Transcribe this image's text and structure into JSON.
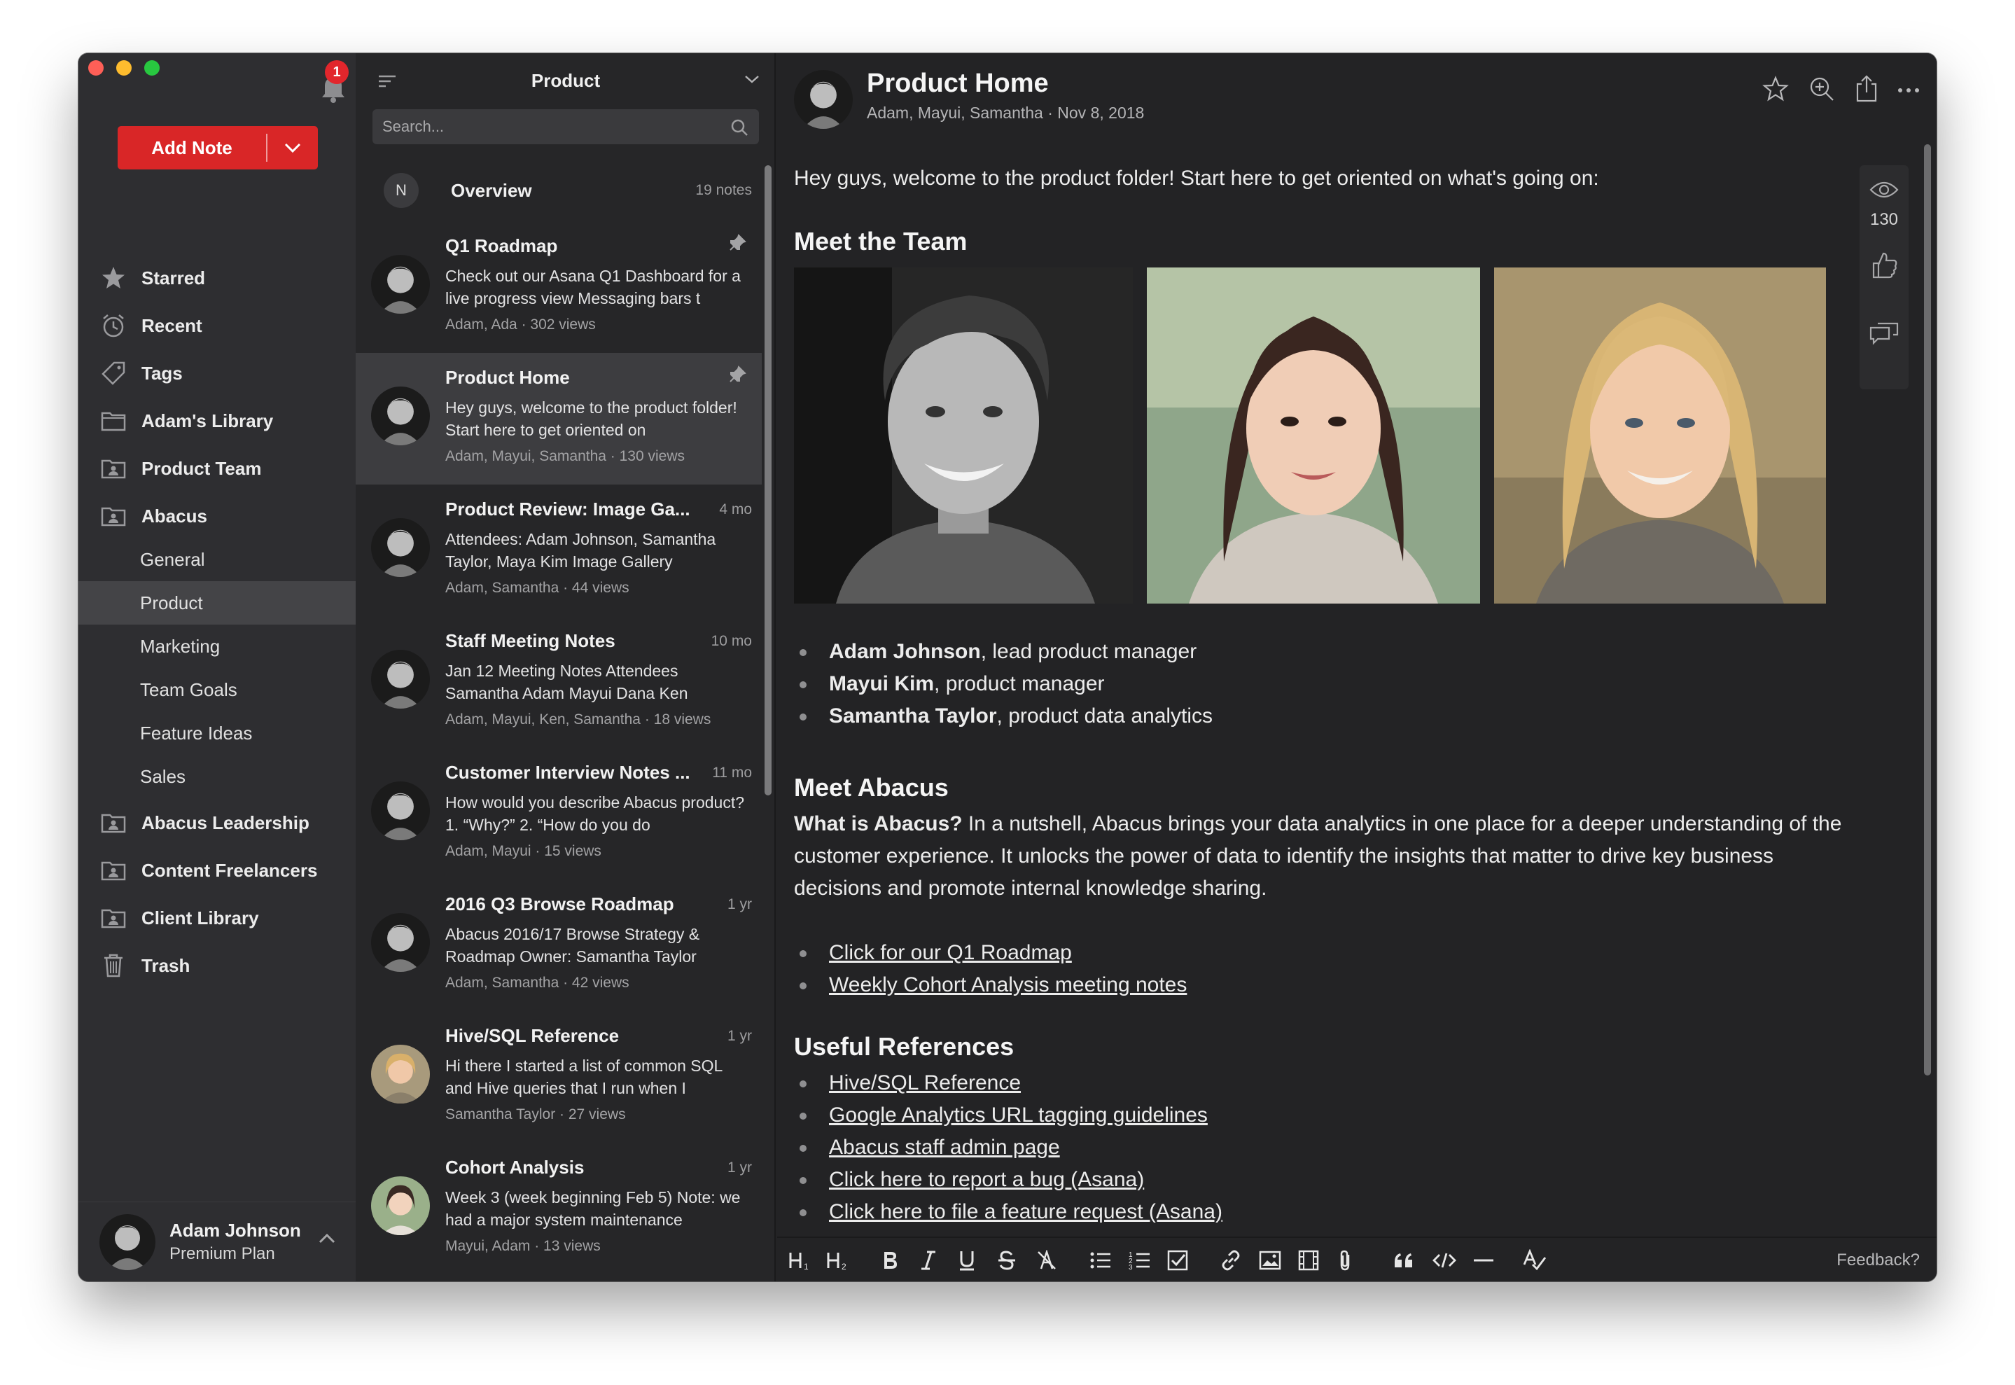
{
  "sidebar": {
    "notification_count": "1",
    "add_note_label": "Add Note",
    "nav": [
      {
        "label": "Starred",
        "icon": "star-icon"
      },
      {
        "label": "Recent",
        "icon": "alarm-clock-icon"
      },
      {
        "label": "Tags",
        "icon": "tag-icon"
      },
      {
        "label": "Adam's Library",
        "icon": "folder-icon"
      },
      {
        "label": "Product Team",
        "icon": "shared-folder-icon"
      },
      {
        "label": "Abacus",
        "icon": "shared-folder-icon"
      }
    ],
    "subnav": [
      "General",
      "Product",
      "Marketing",
      "Team Goals",
      "Feature Ideas",
      "Sales"
    ],
    "nav2": [
      {
        "label": "Abacus Leadership",
        "icon": "shared-folder-icon"
      },
      {
        "label": "Content Freelancers",
        "icon": "shared-folder-icon"
      },
      {
        "label": "Client Library",
        "icon": "shared-folder-icon"
      },
      {
        "label": "Trash",
        "icon": "trash-icon"
      }
    ],
    "profile": {
      "name": "Adam Johnson",
      "plan": "Premium Plan"
    }
  },
  "notelist": {
    "title": "Product",
    "search_placeholder": "Search...",
    "overview": {
      "badge": "N",
      "title": "Overview",
      "count": "19 notes"
    },
    "notes": [
      {
        "title": "Q1 Roadmap",
        "right": "",
        "pinned": true,
        "snippet": "Check out our Asana Q1 Dashboard for a live progress view Messaging bars t",
        "foot": "Adam, Ada · 302 views",
        "avatar": "man"
      },
      {
        "title": "Product Home",
        "right": "",
        "pinned": true,
        "snippet": "Hey guys, welcome to the product folder! Start here to get oriented on",
        "foot": "Adam, Mayui, Samantha · 130 views",
        "avatar": "man"
      },
      {
        "title": "Product Review: Image Ga...",
        "right": "4 mo",
        "pinned": false,
        "snippet": "Attendees: Adam Johnson, Samantha Taylor, Maya Kim Image Gallery",
        "foot": "Adam, Samantha · 44 views",
        "avatar": "man"
      },
      {
        "title": "Staff Meeting Notes",
        "right": "10 mo",
        "pinned": false,
        "snippet": "Jan 12 Meeting Notes Attendees Samantha Adam Mayui Dana Ken",
        "foot": "Adam, Mayui, Ken, Samantha · 18 views",
        "avatar": "man"
      },
      {
        "title": "Customer Interview Notes ...",
        "right": "11 mo",
        "pinned": false,
        "snippet": "How would you describe Abacus product? 1. “Why?” 2. “How do you do",
        "foot": "Adam, Mayui · 15 views",
        "avatar": "man"
      },
      {
        "title": "2016 Q3 Browse Roadmap",
        "right": "1 yr",
        "pinned": false,
        "snippet": "Abacus 2016/17 Browse Strategy & Roadmap Owner: Samantha Taylor",
        "foot": "Adam, Samantha · 42 views",
        "avatar": "man"
      },
      {
        "title": "Hive/SQL Reference",
        "right": "1 yr",
        "pinned": false,
        "snippet": "Hi there I started a list of common SQL and Hive queries that I run when I",
        "foot": "Samantha Taylor · 27 views",
        "avatar": "blonde"
      },
      {
        "title": "Cohort Analysis",
        "right": "1 yr",
        "pinned": false,
        "snippet": "Week 3 (week beginning Feb 5) Note: we had a major system maintenance",
        "foot": "Mayui, Adam · 13 views",
        "avatar": "asian"
      }
    ]
  },
  "editor": {
    "title": "Product Home",
    "subtitle": "Adam, Mayui, Samantha · Nov 8, 2018",
    "view_count": "130",
    "intro": "Hey guys, welcome to the product folder! Start here to get oriented on what's going on:",
    "team_heading": "Meet the Team",
    "team": [
      {
        "name": "Adam Johnson",
        "role": ", lead product manager"
      },
      {
        "name": "Mayui Kim",
        "role": ", product manager"
      },
      {
        "name": "Samantha Taylor",
        "role": ", product data analytics"
      }
    ],
    "abacus_heading": "Meet Abacus",
    "abacus_lead": "What is Abacus?",
    "abacus_text": " In a nutshell, Abacus brings your data analytics in one place for a deeper understanding of the customer experience. It unlocks the power of data to identify the insights that matter to drive key business decisions and promote internal knowledge sharing.",
    "abacus_links": [
      "Click for our Q1 Roadmap",
      "Weekly Cohort Analysis meeting notes"
    ],
    "refs_heading": "Useful References",
    "refs": [
      "Hive/SQL Reference",
      "Google Analytics URL tagging guidelines",
      "Abacus staff admin page",
      "Click here to report a bug (Asana)",
      "Click here to file a feature request (Asana)"
    ],
    "feedback": "Feedback?"
  }
}
